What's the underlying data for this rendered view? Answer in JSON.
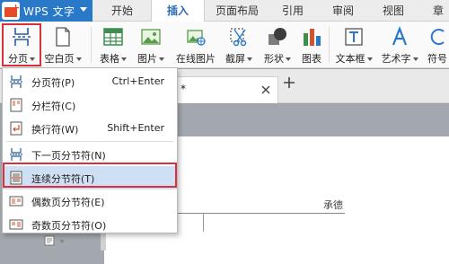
{
  "app": {
    "name": "WPS 文字",
    "logo_icon": "wps-logo-icon",
    "accent_color": "#2a79c9"
  },
  "tabs": [
    {
      "label": "开始"
    },
    {
      "label": "插入",
      "active": true
    },
    {
      "label": "页面布局"
    },
    {
      "label": "引用"
    },
    {
      "label": "审阅"
    },
    {
      "label": "视图"
    },
    {
      "label": "章"
    }
  ],
  "ribbon": {
    "fenye": {
      "label": "分页",
      "icon": "page-break-icon"
    },
    "kongbaiye": {
      "label": "空白页",
      "icon": "blank-page-icon"
    },
    "biaoge": {
      "label": "表格",
      "icon": "table-icon"
    },
    "tupian": {
      "label": "图片",
      "icon": "picture-icon"
    },
    "zaixian": {
      "label": "在线图片",
      "icon": "online-picture-icon"
    },
    "jieping": {
      "label": "截屏",
      "icon": "screenshot-icon"
    },
    "xingzhuang": {
      "label": "形状",
      "icon": "shapes-icon"
    },
    "tubiao": {
      "label": "图表",
      "icon": "chart-icon"
    },
    "wenbenkuang": {
      "label": "文本框",
      "icon": "textbox-icon"
    },
    "yishuzi": {
      "label": "艺术字",
      "icon": "wordart-icon"
    },
    "fuhao": {
      "label": "符号",
      "icon": "symbol-icon"
    }
  },
  "doc_tab": {
    "modified_mark": "*"
  },
  "menu": {
    "items": [
      {
        "label": "分页符(P)",
        "shortcut": "Ctrl+Enter",
        "icon": "page-break-icon"
      },
      {
        "label": "分栏符(C)",
        "shortcut": "",
        "icon": "column-break-icon"
      },
      {
        "label": "换行符(W)",
        "shortcut": "Shift+Enter",
        "icon": "line-break-icon"
      },
      {
        "label": "下一页分节符(N)",
        "shortcut": "",
        "icon": "next-page-section-icon"
      },
      {
        "label": "连续分节符(T)",
        "shortcut": "",
        "icon": "continuous-section-icon",
        "selected": true
      },
      {
        "label": "偶数页分节符(E)",
        "shortcut": "",
        "icon": "even-page-section-icon"
      },
      {
        "label": "奇数页分节符(O)",
        "shortcut": "",
        "icon": "odd-page-section-icon"
      }
    ]
  },
  "document": {
    "header_text": "承德"
  },
  "highlight_color": "#d8313b"
}
